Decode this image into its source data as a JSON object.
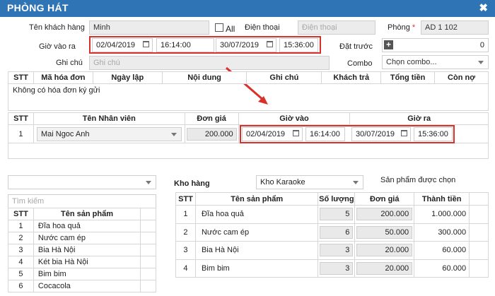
{
  "dialog": {
    "title": "PHÒNG HÁT",
    "close": "✖"
  },
  "form": {
    "customer_label": "Tên khách hàng",
    "customer_value": "Minh",
    "all_label": "All",
    "phone_label": "Điện thoại",
    "phone_placeholder": "Điện thoại",
    "room_label": "Phòng",
    "room_required": "*",
    "room_value": "AD 1 102",
    "time_label": "Giờ vào ra",
    "in_date": "02/04/2019",
    "in_time": "16:14:00",
    "out_date": "30/07/2019",
    "out_time": "15:36:00",
    "deposit_label": "Đặt trước",
    "deposit_value": "0",
    "note_label": "Ghi chú",
    "note_placeholder": "Ghi chú",
    "combo_label": "Combo",
    "combo_value": "Chọn combo..."
  },
  "invoices": {
    "headers": [
      "STT",
      "Mã hóa đơn",
      "Ngày lập",
      "Nội dung",
      "Ghi chú",
      "Khách trả",
      "Tổng tiền",
      "Còn nợ"
    ],
    "empty": "Không có hóa đơn ký gửi"
  },
  "staff": {
    "headers": [
      "STT",
      "Tên Nhân viên",
      "Đơn giá",
      "Giờ vào",
      "Giờ ra"
    ],
    "row": {
      "stt": "1",
      "name": "Mai Ngoc Anh",
      "price": "200.000",
      "in_date": "02/04/2019",
      "in_time": "16:14:00",
      "out_date": "30/07/2019",
      "out_time": "15:36:00"
    }
  },
  "left": {
    "search_placeholder": "Tìm kiếm",
    "headers": [
      "STT",
      "Tên sản phẩm"
    ],
    "rows": [
      {
        "stt": "1",
        "name": "Đĩa hoa quả"
      },
      {
        "stt": "2",
        "name": "Nước cam ép"
      },
      {
        "stt": "3",
        "name": "Bia Hà Nội"
      },
      {
        "stt": "4",
        "name": "Két bia Hà Nội"
      },
      {
        "stt": "5",
        "name": "Bim bim"
      },
      {
        "stt": "6",
        "name": "Cocacola"
      }
    ]
  },
  "warehouse": {
    "label": "Kho hàng",
    "value": "Kho Karaoke",
    "selected_label": "Sản phẩm được chọn"
  },
  "products": {
    "headers": [
      "STT",
      "Tên sản phẩm",
      "Số lượng",
      "Đơn giá",
      "Thành tiền"
    ],
    "rows": [
      {
        "stt": "1",
        "name": "Đĩa hoa quả",
        "qty": "5",
        "price": "200.000",
        "total": "1.000.000"
      },
      {
        "stt": "2",
        "name": "Nước cam ép",
        "qty": "6",
        "price": "50.000",
        "total": "300.000"
      },
      {
        "stt": "3",
        "name": "Bia Hà Nội",
        "qty": "3",
        "price": "20.000",
        "total": "60.000"
      },
      {
        "stt": "4",
        "name": "Bim bim",
        "qty": "3",
        "price": "20.000",
        "total": "60.000"
      }
    ]
  },
  "colors": {
    "titlebar": "#2f74b5",
    "highlight": "#d9302c"
  }
}
